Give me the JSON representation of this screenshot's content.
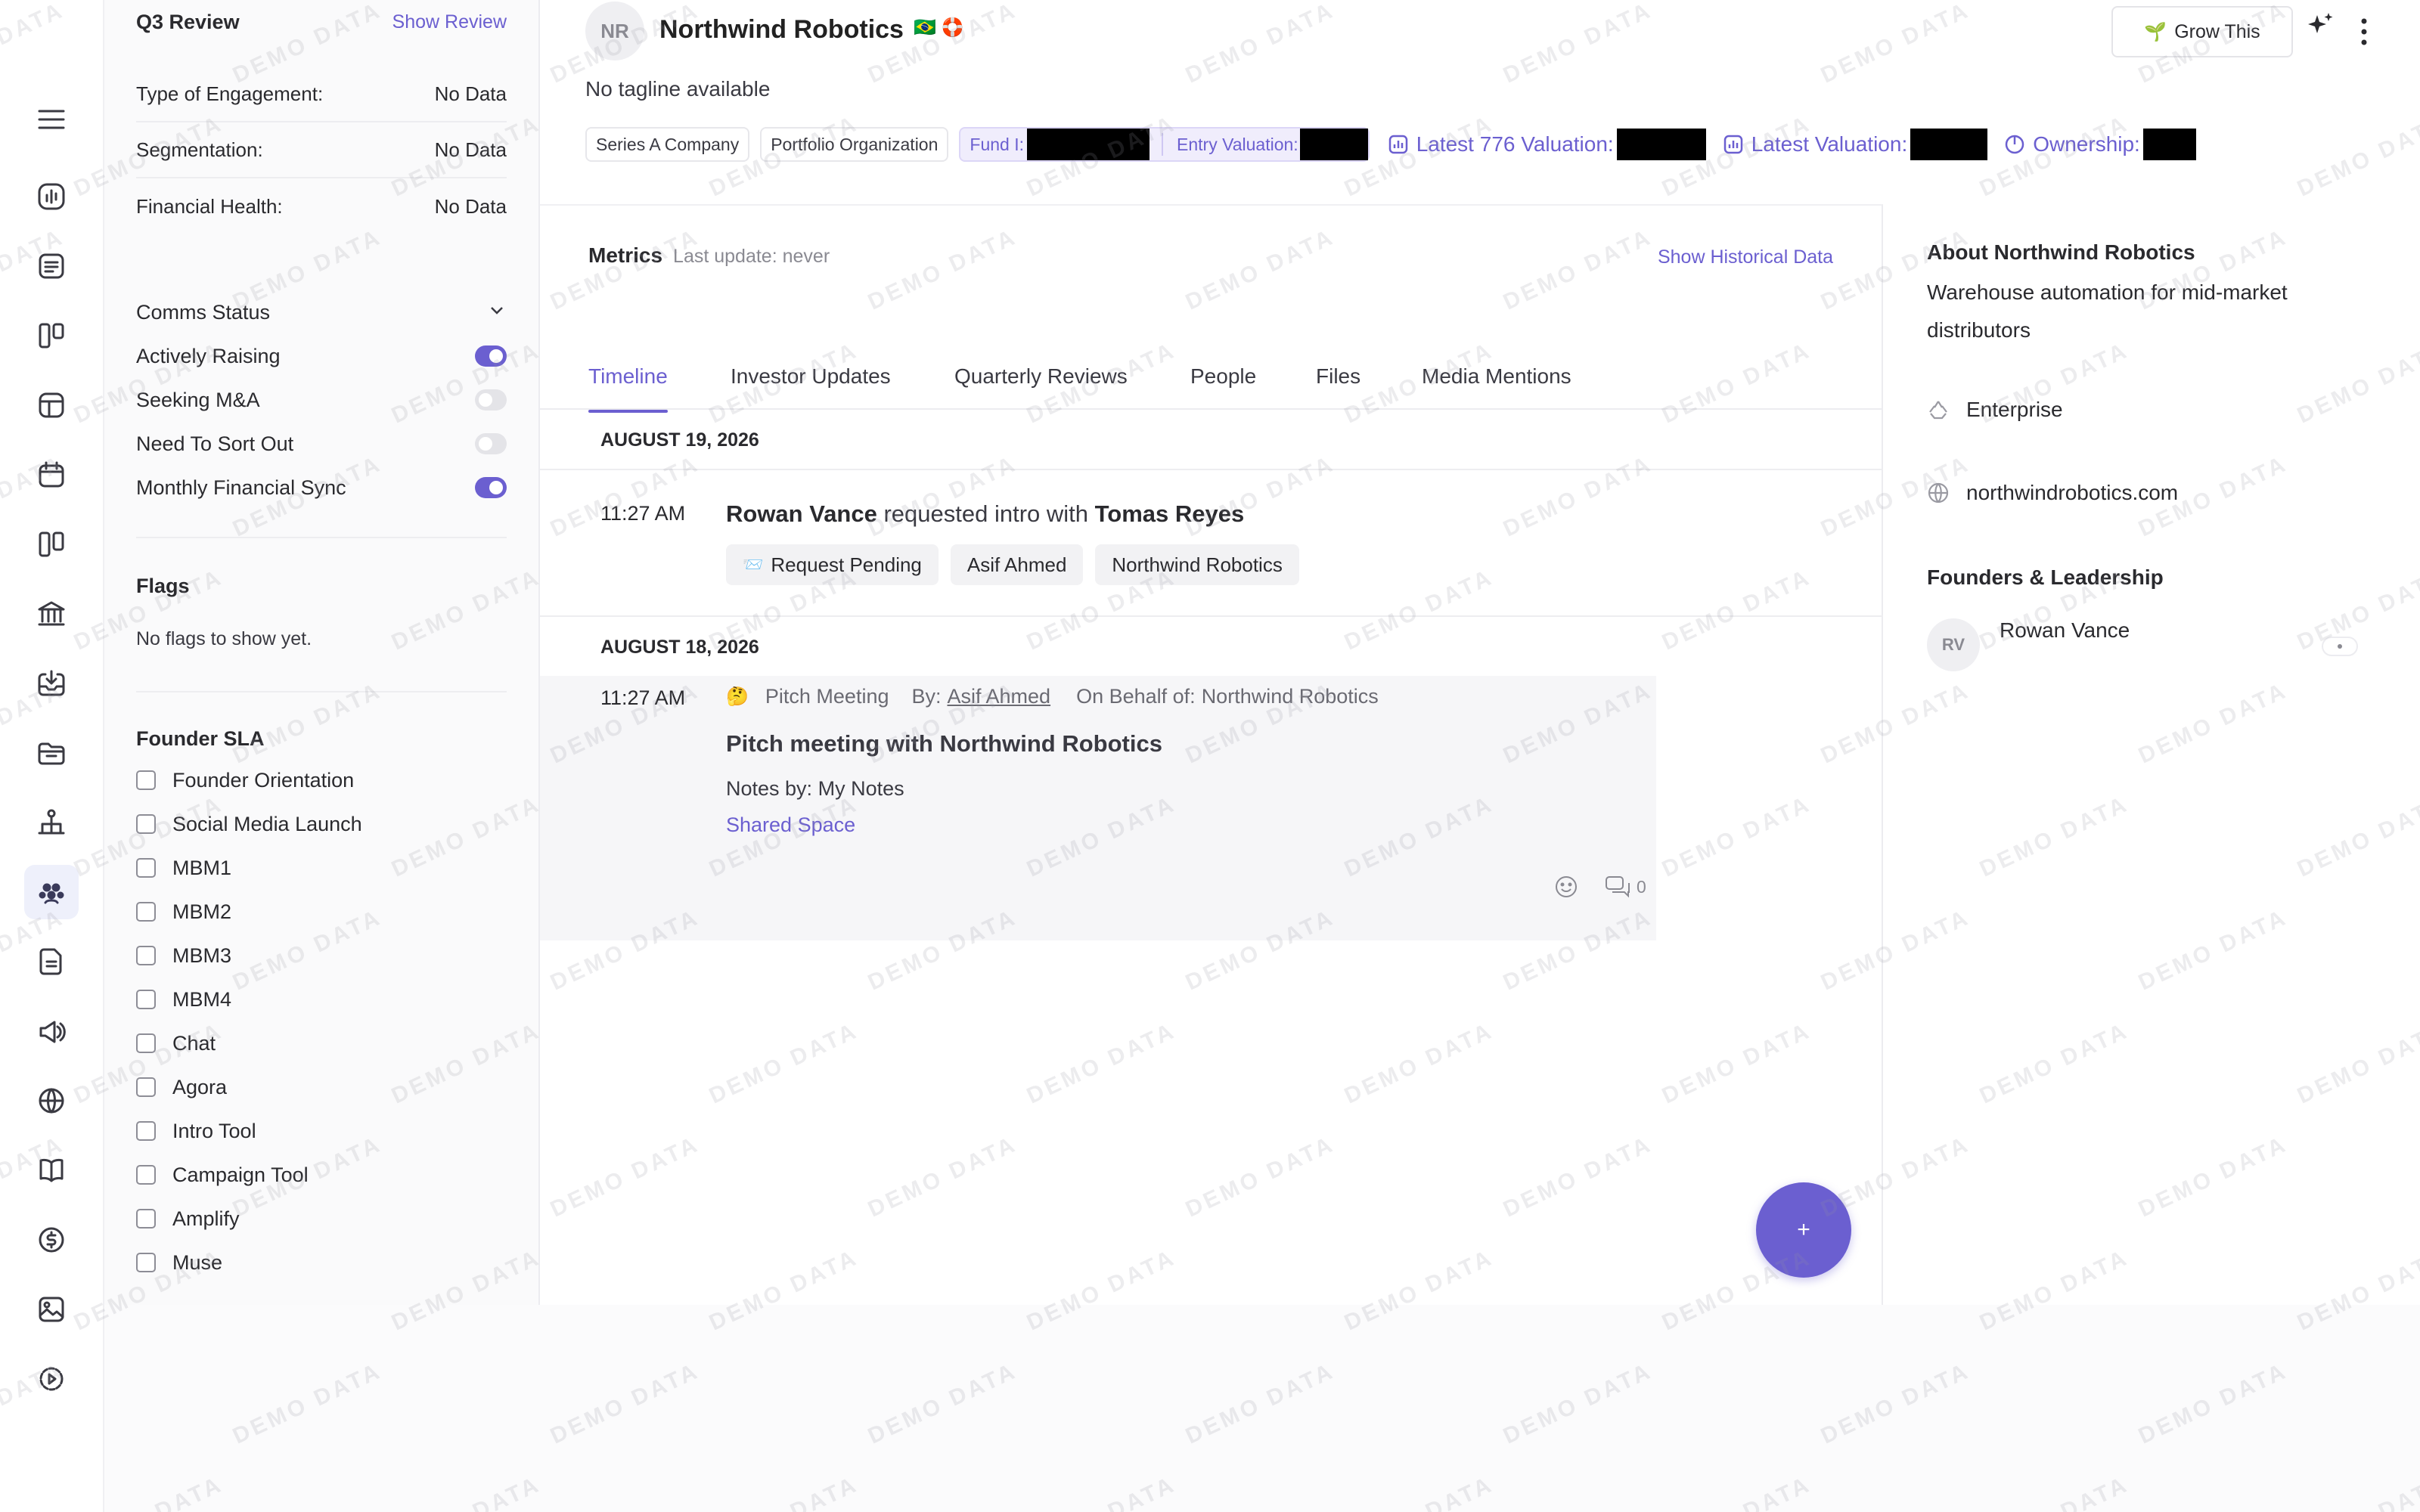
{
  "brand": {
    "accent": "#6b5fd0",
    "toggle_on": "#6b5fd0",
    "redaction": "#000000"
  },
  "rail": {
    "icons": [
      "menu-icon",
      "pulse-icon",
      "note-icon",
      "kanban-icon",
      "layout-icon",
      "calendar-icon",
      "board-icon",
      "bank-icon",
      "inbox-icon",
      "folder-icon",
      "org-chart-icon",
      "people-icon",
      "document-icon",
      "megaphone-icon",
      "globe-icon",
      "book-icon",
      "dollar-icon",
      "image-icon",
      "play-icon"
    ],
    "active": "people-icon"
  },
  "review": {
    "title": "Q3 Review",
    "show_link": "Show Review",
    "rows": [
      {
        "label": "Type of Engagement:",
        "value": "No Data"
      },
      {
        "label": "Segmentation:",
        "value": "No Data"
      },
      {
        "label": "Financial Health:",
        "value": "No Data"
      }
    ]
  },
  "comms": {
    "title": "Comms Status",
    "toggles": [
      {
        "label": "Actively Raising",
        "on": true
      },
      {
        "label": "Seeking M&A",
        "on": false
      },
      {
        "label": "Need To Sort Out",
        "on": false
      },
      {
        "label": "Monthly Financial Sync",
        "on": true
      }
    ]
  },
  "flags": {
    "title": "Flags",
    "empty": "No flags to show yet."
  },
  "sla": {
    "title": "Founder SLA",
    "items": [
      "Founder Orientation",
      "Social Media Launch",
      "MBM1",
      "MBM2",
      "MBM3",
      "MBM4",
      "Chat",
      "Agora",
      "Intro Tool",
      "Campaign Tool",
      "Amplify",
      "Muse"
    ]
  },
  "company": {
    "initials": "NR",
    "name": "Northwind Robotics",
    "tagline": "No tagline available",
    "flags_emoji": "🇧🇷 🛟",
    "chips": [
      "Series A Company",
      "Portfolio Organization"
    ],
    "fund_label": "Fund I:",
    "entry_label": "Entry Valuation:",
    "metrics": [
      "Latest 776 Valuation:",
      "Latest Valuation:",
      "Ownership:"
    ],
    "grow_button": "Grow This"
  },
  "metrics_section": {
    "title": "Metrics",
    "updated": "Last update: never",
    "history_link": "Show Historical Data"
  },
  "tabs": [
    "Timeline",
    "Investor Updates",
    "Quarterly Reviews",
    "People",
    "Files",
    "Media Mentions"
  ],
  "timeline": [
    {
      "date": "AUGUST 19, 2026",
      "time": "11:27 AM",
      "actor": "Rowan Vance",
      "verb": "requested intro with",
      "target": "Tomas Reyes",
      "pills": [
        "Request Pending",
        "Asif Ahmed",
        "Northwind Robotics"
      ]
    },
    {
      "date": "AUGUST 18, 2026",
      "time": "11:27 AM",
      "emoji": "🤔",
      "type": "Pitch Meeting",
      "by_label": "By:",
      "by": "Asif Ahmed",
      "behalf_label": "On Behalf of:",
      "behalf": "Northwind Robotics",
      "title": "Pitch meeting with Northwind Robotics",
      "notes_label": "Notes by:",
      "notes_by": "My Notes",
      "space": "Shared Space",
      "comments": "0"
    }
  ],
  "fab": "+",
  "about": {
    "title": "About Northwind Robotics",
    "desc": "Warehouse automation for mid-market distributors",
    "type": "Enterprise",
    "website": "northwindrobotics.com",
    "founders_title": "Founders & Leadership",
    "founder_initials": "RV",
    "founder_name": "Rowan Vance"
  },
  "watermark": "DEMO DATA"
}
